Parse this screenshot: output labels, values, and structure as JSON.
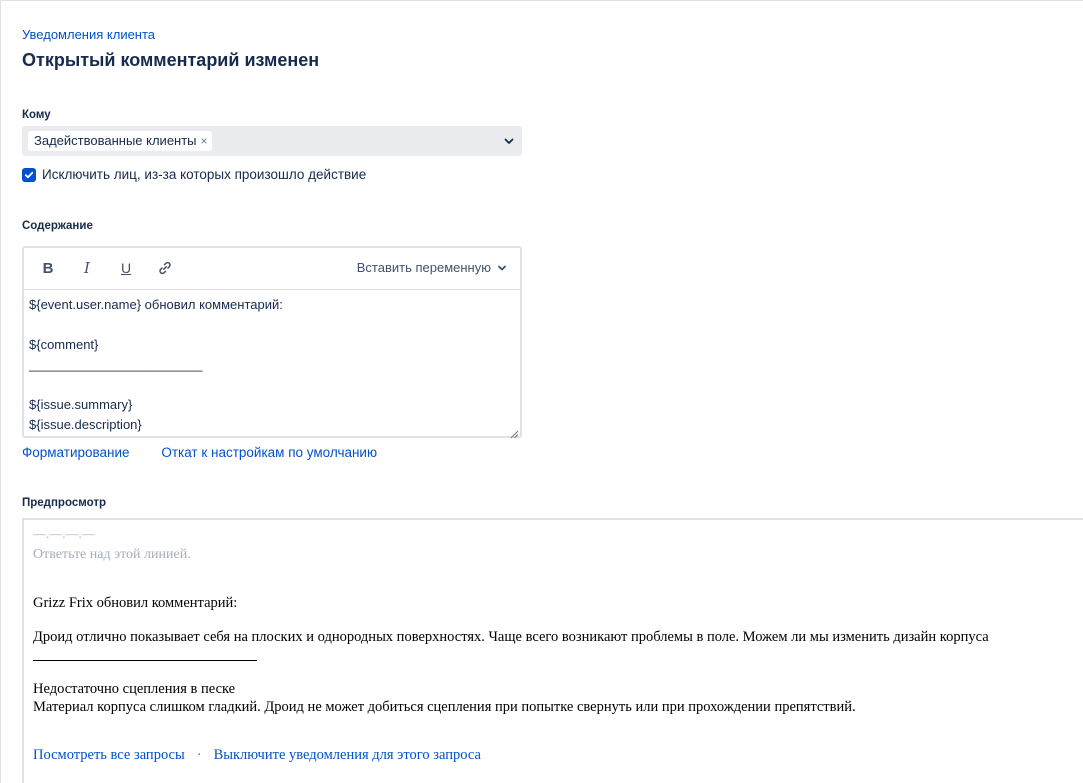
{
  "breadcrumb": "Уведомления клиента",
  "title": "Открытый комментарий изменен",
  "recipients": {
    "label": "Кому",
    "tags": [
      "Задействованные клиенты"
    ],
    "tag_remove_glyph": "×"
  },
  "exclude_checkbox": {
    "label": "Исключить лиц, из-за которых произошло действие",
    "checked": true
  },
  "content": {
    "label": "Содержание",
    "toolbar": {
      "bold": "B",
      "italic": "I",
      "underline": "U",
      "insert_variable": "Вставить переменную"
    },
    "lines": [
      "${event.user.name} обновил комментарий:",
      "",
      "${comment}",
      "________________________",
      "",
      "${issue.summary}",
      "${issue.description}"
    ]
  },
  "editor_links": {
    "formatting": "Форматирование",
    "reset": "Откат к настройкам по умолчанию"
  },
  "preview": {
    "label": "Предпросмотр",
    "dashes": "—.—.—.—",
    "reply_above": "Ответьте над этой линией.",
    "updated_line": "Grizz Frix обновил комментарий:",
    "comment": "Дроид отлично показывает себя на плоских и однородных поверхностях. Чаще всего возникают проблемы в поле. Можем ли мы изменить дизайн корпуса",
    "summary": "Недостаточно сцепления в песке",
    "description": "Материал корпуса слишком гладкий. Дроид не может добиться сцепления при попытке свернуть или при прохождении препятствий.",
    "footer": {
      "view_all": "Посмотреть все запросы",
      "separator": "·",
      "unsubscribe": "Выключите уведомления для этого запроса"
    }
  },
  "colors": {
    "link": "#0052cc",
    "text": "#172b4d",
    "select_bg": "#ebecf0",
    "checkbox": "#0052cc",
    "border": "#dfe1e6"
  }
}
